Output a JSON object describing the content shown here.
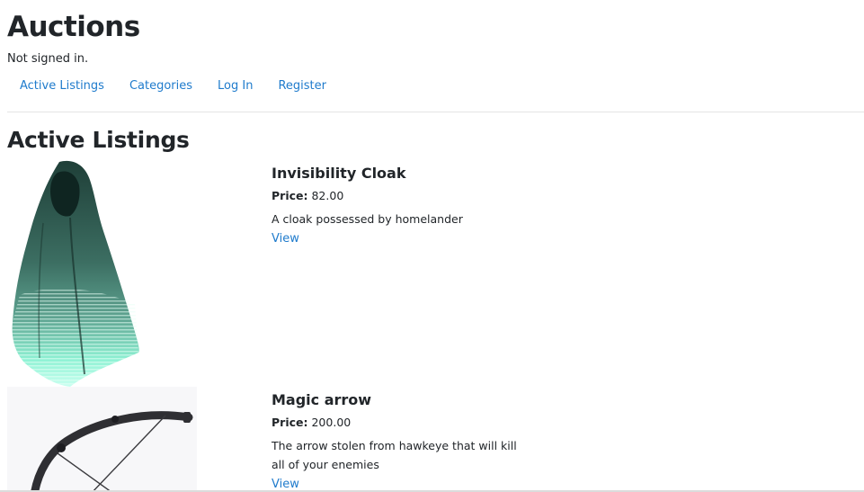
{
  "site": {
    "title": "Auctions",
    "signin_status": "Not signed in."
  },
  "nav": {
    "items": [
      {
        "label": "Active Listings"
      },
      {
        "label": "Categories"
      },
      {
        "label": "Log In"
      },
      {
        "label": "Register"
      }
    ]
  },
  "main": {
    "heading": "Active Listings",
    "listings": [
      {
        "title": "Invisibility Cloak",
        "price_label": "Price:",
        "price": "82.00",
        "description": "A cloak possessed by homelander",
        "view_label": "View",
        "image_icon": "cloak-image"
      },
      {
        "title": "Magic arrow",
        "price_label": "Price:",
        "price": "200.00",
        "description": "The arrow stolen from hawkeye that will kill all of your enemies",
        "view_label": "View",
        "image_icon": "bow-image"
      }
    ]
  },
  "colors": {
    "link": "#1f7bcc",
    "text": "#212529",
    "divider": "#e5e5e5"
  }
}
